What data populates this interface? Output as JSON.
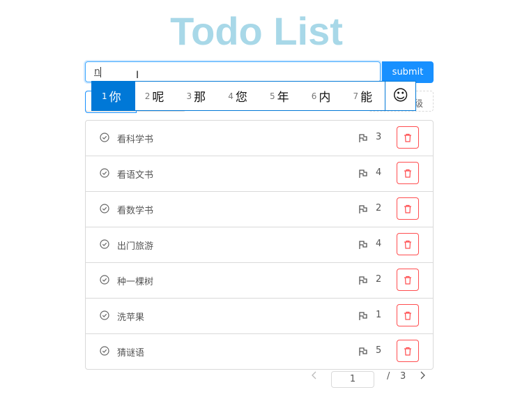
{
  "title": "Todo List",
  "input": {
    "value": "n"
  },
  "submit_label": "submit",
  "priority_button_label": "级",
  "ime": {
    "candidates": [
      {
        "n": "1",
        "c": "你"
      },
      {
        "n": "2",
        "c": "呢"
      },
      {
        "n": "3",
        "c": "那"
      },
      {
        "n": "4",
        "c": "您"
      },
      {
        "n": "5",
        "c": "年"
      },
      {
        "n": "6",
        "c": "内"
      },
      {
        "n": "7",
        "c": "能"
      }
    ],
    "emoji": "☺"
  },
  "todos": [
    {
      "text": "看科学书",
      "priority": "3"
    },
    {
      "text": "看语文书",
      "priority": "4"
    },
    {
      "text": "看数学书",
      "priority": "2"
    },
    {
      "text": "出门旅游",
      "priority": "4"
    },
    {
      "text": "种一棵树",
      "priority": "2"
    },
    {
      "text": "洗苹果",
      "priority": "1"
    },
    {
      "text": "猜谜语",
      "priority": "5"
    }
  ],
  "pagination": {
    "current": "1",
    "separator": "/",
    "total": "3"
  },
  "colors": {
    "accent": "#1890ff",
    "danger": "#ff4d4f",
    "title": "#a8d8e8"
  }
}
